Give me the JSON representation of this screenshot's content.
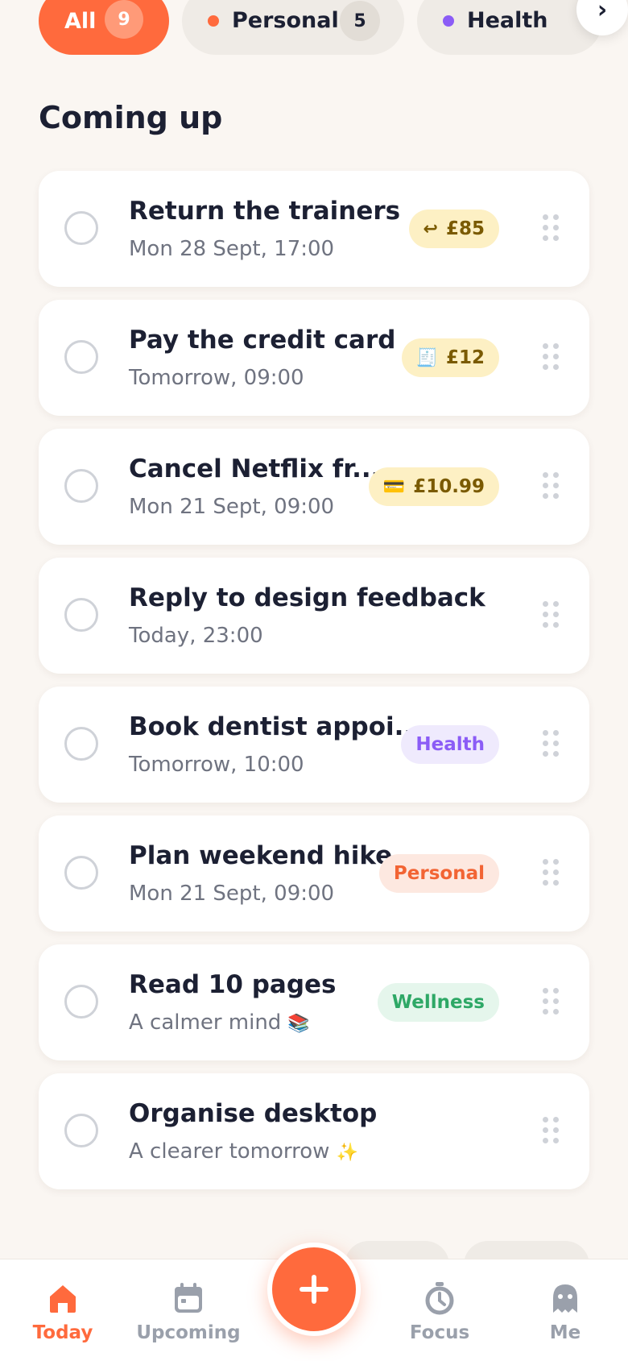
{
  "filters": [
    {
      "label": "All",
      "count": "9"
    },
    {
      "label": "Personal",
      "count": "5",
      "color": "#ff6a3d"
    },
    {
      "label": "Health",
      "color": "#8b5cf6"
    }
  ],
  "scroll_icon": "chevron-right-icon",
  "section_title": "Coming up",
  "tasks": [
    {
      "title": "Return the trainers",
      "subtitle": "Mon 28 Sept, 17:00",
      "badge": {
        "type": "money",
        "icon": "return-icon",
        "glyph": "↩",
        "text": "£85"
      }
    },
    {
      "title": "Pay the credit card",
      "subtitle": "Tomorrow, 09:00",
      "badge": {
        "type": "money",
        "icon": "receipt-icon",
        "glyph": "🧾",
        "text": "£12"
      }
    },
    {
      "title": "Cancel Netflix fr...",
      "subtitle": "Mon 21 Sept, 09:00",
      "badge": {
        "type": "money",
        "icon": "credit-card-icon",
        "glyph": "💳",
        "text": "£10.99"
      }
    },
    {
      "title": "Reply to design feedback",
      "subtitle": "Today, 23:00"
    },
    {
      "title": "Book dentist appoi...",
      "subtitle": "Tomorrow, 10:00",
      "badge": {
        "type": "health",
        "text": "Health"
      }
    },
    {
      "title": "Plan weekend hike",
      "subtitle": "Mon 21 Sept, 09:00",
      "badge": {
        "type": "personal",
        "text": "Personal"
      }
    },
    {
      "title": "Read 10 pages",
      "subtitle": "A calmer mind",
      "subtitle_emoji": "📚",
      "badge": {
        "type": "wellness",
        "text": "Wellness"
      }
    },
    {
      "title": "Organise desktop",
      "subtitle": "A clearer tomorrow",
      "subtitle_emoji": "✨"
    }
  ],
  "nav": {
    "items": [
      {
        "label": "Today",
        "icon": "home-icon",
        "active": true
      },
      {
        "label": "Upcoming",
        "icon": "calendar-icon"
      },
      {
        "label": "Focus",
        "icon": "timer-icon"
      },
      {
        "label": "Me",
        "icon": "ghost-profile-icon"
      }
    ],
    "add_icon": "plus-icon"
  },
  "colors": {
    "accent": "#ff6a3d",
    "background": "#faf6f2",
    "health": "#8b5cf6",
    "wellness": "#2ea866"
  }
}
